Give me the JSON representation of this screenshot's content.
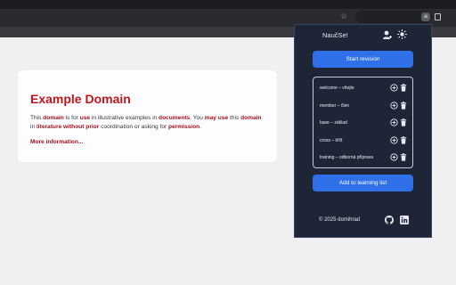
{
  "browser": {
    "icons": [
      "star-icon",
      "address-field",
      "extension-icon",
      "tab-strip-icon"
    ],
    "extension_icon_glyph": "≡"
  },
  "page": {
    "heading": "Example Domain",
    "body": [
      {
        "text": "This ",
        "hl": false
      },
      {
        "text": "domain",
        "hl": true
      },
      {
        "text": " is for ",
        "hl": false
      },
      {
        "text": "use",
        "hl": true
      },
      {
        "text": " in illustrative examples in ",
        "hl": false
      },
      {
        "text": "documents",
        "hl": true
      },
      {
        "text": ". You ",
        "hl": false
      },
      {
        "text": "may use",
        "hl": true
      },
      {
        "text": " this ",
        "hl": false
      },
      {
        "text": "domain",
        "hl": true
      },
      {
        "text": " in ",
        "hl": false
      },
      {
        "text": "literature without prior",
        "hl": true
      },
      {
        "text": " coordination or asking for ",
        "hl": false
      },
      {
        "text": "permission",
        "hl": true
      },
      {
        "text": ".",
        "hl": false
      }
    ],
    "link": "More information..."
  },
  "popup": {
    "title": "NaučSe!",
    "icons": [
      "profile-icon",
      "theme-sun-icon"
    ],
    "start_label": "Start revision",
    "vocab": [
      {
        "text": "welcome – vítejte"
      },
      {
        "text": "member – člen"
      },
      {
        "text": "base – základ"
      },
      {
        "text": "cross – kříž"
      },
      {
        "text": "training – odborná příprava"
      }
    ],
    "row_icons": [
      "edit-icon",
      "trash-icon"
    ],
    "add_label": "Add to learning list",
    "footer": "© 2025 domihrad",
    "social_icons": [
      "github-icon",
      "linkedin-icon"
    ]
  },
  "colors": {
    "popup_bg": "#1e2537",
    "accent": "#2f6fe8",
    "page_heading": "#c0161b",
    "highlight": "#a3121c"
  }
}
